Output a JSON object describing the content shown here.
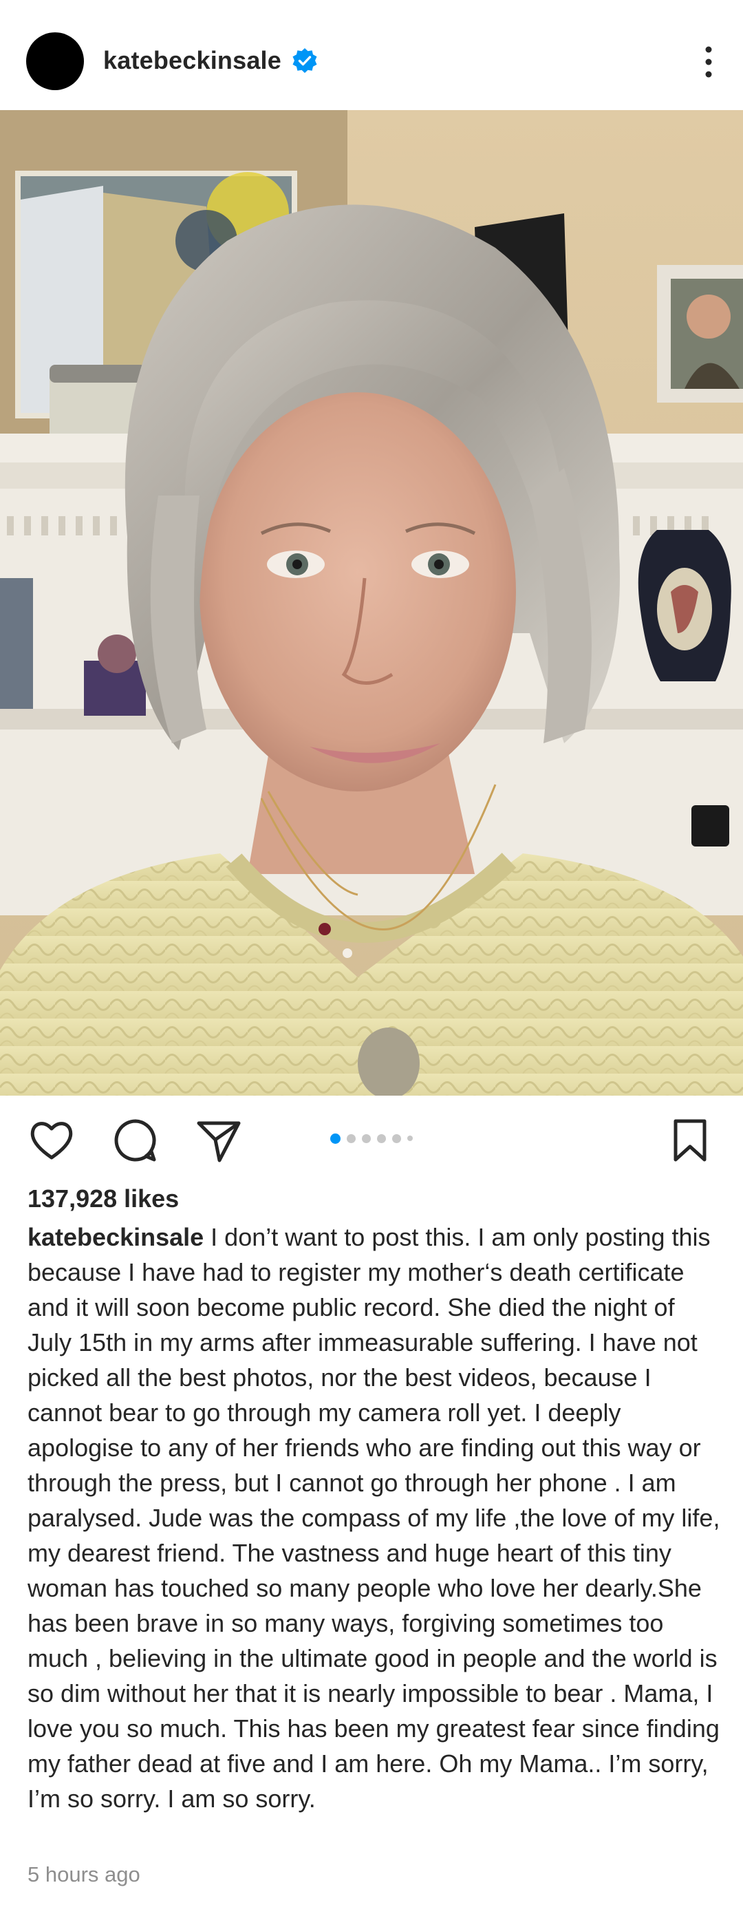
{
  "header": {
    "username": "katebeckinsale",
    "verified_icon": "verified-badge-icon",
    "more_icon": "more-vertical-icon",
    "accent_color": "#0095f6"
  },
  "post": {
    "photo_description_icon": "post-photo",
    "carousel": {
      "total": 6,
      "active_index": 0
    }
  },
  "actions": {
    "like_icon": "heart-icon",
    "comment_icon": "comment-icon",
    "share_icon": "send-icon",
    "save_icon": "bookmark-icon"
  },
  "likes": "137,928 likes",
  "caption": {
    "username": "katebeckinsale",
    "text": " I don’t want to post this. I am only posting this because I have had to register my mother‘s death certificate and it will soon become public record. She died the night of July 15th  in my arms after immeasurable suffering. I have not picked all the best photos, nor the best videos, because I cannot bear to go through my camera roll yet. I deeply apologise to any of her friends who are finding out this way or through the press, but I cannot go through her phone . I am paralysed. Jude was the compass of my life ,the love of my life, my dearest friend. The vastness and huge heart  of this tiny woman has touched so many people who love her dearly.She has been brave in so many ways, forgiving sometimes too much , believing in the ultimate good in people and the world is so dim without her that it is nearly impossible to bear . Mama, I love you so much. This has been my greatest fear since finding my father dead at five and I am here. Oh my Mama.. I’m  sorry, I’m so sorry. I am so sorry."
  },
  "timestamp": "5 hours ago"
}
